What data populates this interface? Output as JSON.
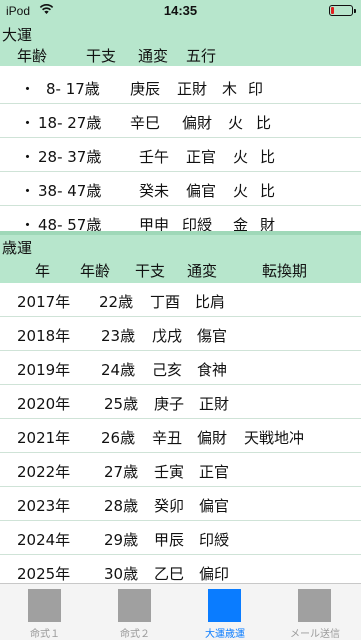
{
  "status": {
    "carrier": "iPod",
    "time": "14:35",
    "battery_color": "#e02020"
  },
  "taiun": {
    "title": "大運",
    "columns": [
      "年齢",
      "干支",
      "通変",
      "五行"
    ],
    "rows": [
      {
        "bullet": "・",
        "age": "8- 17歳",
        "kanshi": "庚辰",
        "tsuhen": "正財",
        "gogyo1": "木",
        "gogyo2": "印"
      },
      {
        "bullet": "・",
        "age": "18- 27歳",
        "kanshi": "辛巳",
        "tsuhen": "偏財",
        "gogyo1": "火",
        "gogyo2": "比"
      },
      {
        "bullet": "・",
        "age": "28- 37歳",
        "kanshi": "壬午",
        "tsuhen": "正官",
        "gogyo1": "火",
        "gogyo2": "比"
      },
      {
        "bullet": "・",
        "age": "38- 47歳",
        "kanshi": "癸未",
        "tsuhen": "偏官",
        "gogyo1": "火",
        "gogyo2": "比"
      },
      {
        "bullet": "・",
        "age": "48- 57歳",
        "kanshi": "甲申",
        "tsuhen": "印綬",
        "gogyo1": "金",
        "gogyo2": "財"
      }
    ]
  },
  "saiun": {
    "title": "歳運",
    "columns": [
      "年",
      "年齢",
      "干支",
      "通変",
      "転換期"
    ],
    "rows": [
      {
        "year": "2017年",
        "age": "22歳",
        "kanshi": "丁酉",
        "tsuhen": "比肩",
        "tenkan": ""
      },
      {
        "year": "2018年",
        "age": "23歳",
        "kanshi": "戊戌",
        "tsuhen": "傷官",
        "tenkan": ""
      },
      {
        "year": "2019年",
        "age": "24歳",
        "kanshi": "己亥",
        "tsuhen": "食神",
        "tenkan": ""
      },
      {
        "year": "2020年",
        "age": "25歳",
        "kanshi": "庚子",
        "tsuhen": "正財",
        "tenkan": ""
      },
      {
        "year": "2021年",
        "age": "26歳",
        "kanshi": "辛丑",
        "tsuhen": "偏財",
        "tenkan": "天戦地冲"
      },
      {
        "year": "2022年",
        "age": "27歳",
        "kanshi": "壬寅",
        "tsuhen": "正官",
        "tenkan": ""
      },
      {
        "year": "2023年",
        "age": "28歳",
        "kanshi": "癸卯",
        "tsuhen": "偏官",
        "tenkan": ""
      },
      {
        "year": "2024年",
        "age": "29歳",
        "kanshi": "甲辰",
        "tsuhen": "印綬",
        "tenkan": ""
      },
      {
        "year": "2025年",
        "age": "30歳",
        "kanshi": "乙巳",
        "tsuhen": "偏印",
        "tenkan": ""
      }
    ]
  },
  "tabs": [
    {
      "label": "命式１",
      "active": false
    },
    {
      "label": "命式２",
      "active": false
    },
    {
      "label": "大運歳運",
      "active": true
    },
    {
      "label": "メール送信",
      "active": false
    }
  ]
}
